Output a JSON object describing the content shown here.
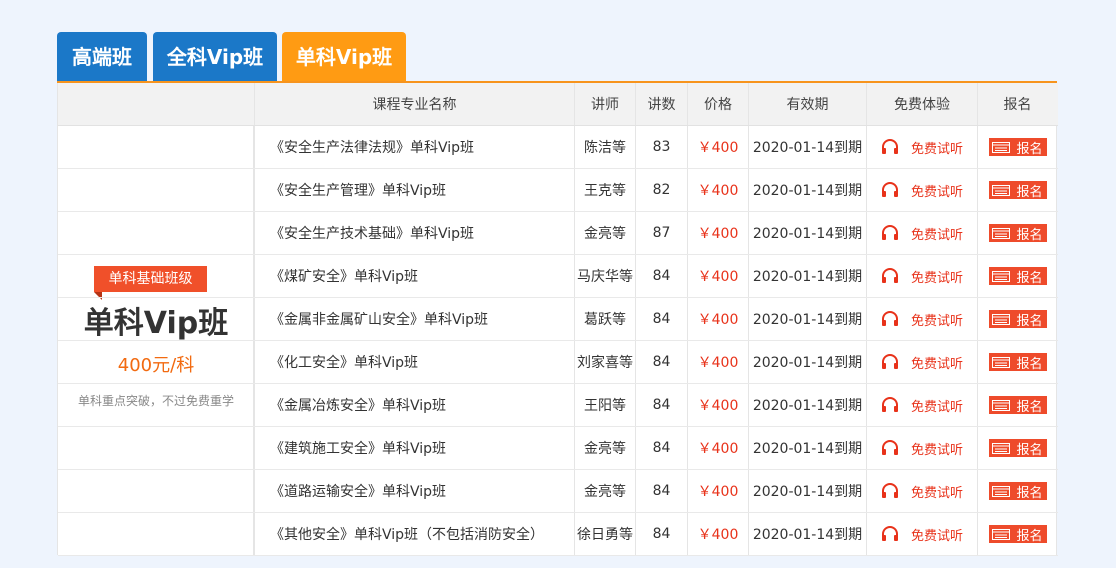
{
  "tabs": [
    {
      "label": "高端班"
    },
    {
      "label": "全科Vip班"
    },
    {
      "label": "单科Vip班"
    }
  ],
  "header": [
    "",
    "课程专业名称",
    "讲师",
    "讲数",
    "价格",
    "有效期",
    "免费体验",
    "报名"
  ],
  "panel": {
    "badge": "单科基础班级",
    "title": "单科Vip班",
    "price": "400元/科",
    "note": "单科重点突破，不过免费重学"
  },
  "rows": [
    {
      "name": "《安全生产法律法规》单科Vip班",
      "teacher": "陈洁等",
      "lectures": "83",
      "price": "￥400",
      "validity": "2020-01-14到期",
      "trial": "免费试听",
      "enroll": "报名"
    },
    {
      "name": "《安全生产管理》单科Vip班",
      "teacher": "王克等",
      "lectures": "82",
      "price": "￥400",
      "validity": "2020-01-14到期",
      "trial": "免费试听",
      "enroll": "报名"
    },
    {
      "name": "《安全生产技术基础》单科Vip班",
      "teacher": "金亮等",
      "lectures": "87",
      "price": "￥400",
      "validity": "2020-01-14到期",
      "trial": "免费试听",
      "enroll": "报名"
    },
    {
      "name": "《煤矿安全》单科Vip班",
      "teacher": "马庆华等",
      "lectures": "84",
      "price": "￥400",
      "validity": "2020-01-14到期",
      "trial": "免费试听",
      "enroll": "报名"
    },
    {
      "name": "《金属非金属矿山安全》单科Vip班",
      "teacher": "葛跃等",
      "lectures": "84",
      "price": "￥400",
      "validity": "2020-01-14到期",
      "trial": "免费试听",
      "enroll": "报名"
    },
    {
      "name": "《化工安全》单科Vip班",
      "teacher": "刘家喜等",
      "lectures": "84",
      "price": "￥400",
      "validity": "2020-01-14到期",
      "trial": "免费试听",
      "enroll": "报名"
    },
    {
      "name": "《金属冶炼安全》单科Vip班",
      "teacher": "王阳等",
      "lectures": "84",
      "price": "￥400",
      "validity": "2020-01-14到期",
      "trial": "免费试听",
      "enroll": "报名"
    },
    {
      "name": "《建筑施工安全》单科Vip班",
      "teacher": "金亮等",
      "lectures": "84",
      "price": "￥400",
      "validity": "2020-01-14到期",
      "trial": "免费试听",
      "enroll": "报名"
    },
    {
      "name": "《道路运输安全》单科Vip班",
      "teacher": "金亮等",
      "lectures": "84",
      "price": "￥400",
      "validity": "2020-01-14到期",
      "trial": "免费试听",
      "enroll": "报名"
    },
    {
      "name": "《其他安全》单科Vip班（不包括消防安全）",
      "teacher": "徐日勇等",
      "lectures": "84",
      "price": "￥400",
      "validity": "2020-01-14到期",
      "trial": "免费试听",
      "enroll": "报名"
    }
  ],
  "icons": {
    "trial": "headphones-icon",
    "enroll": "notepad-icon"
  },
  "colors": {
    "tab_blue": "#1b78c8",
    "tab_active": "#ff9b13",
    "accent_red": "#e8321a",
    "price_orange": "#f26a10"
  }
}
